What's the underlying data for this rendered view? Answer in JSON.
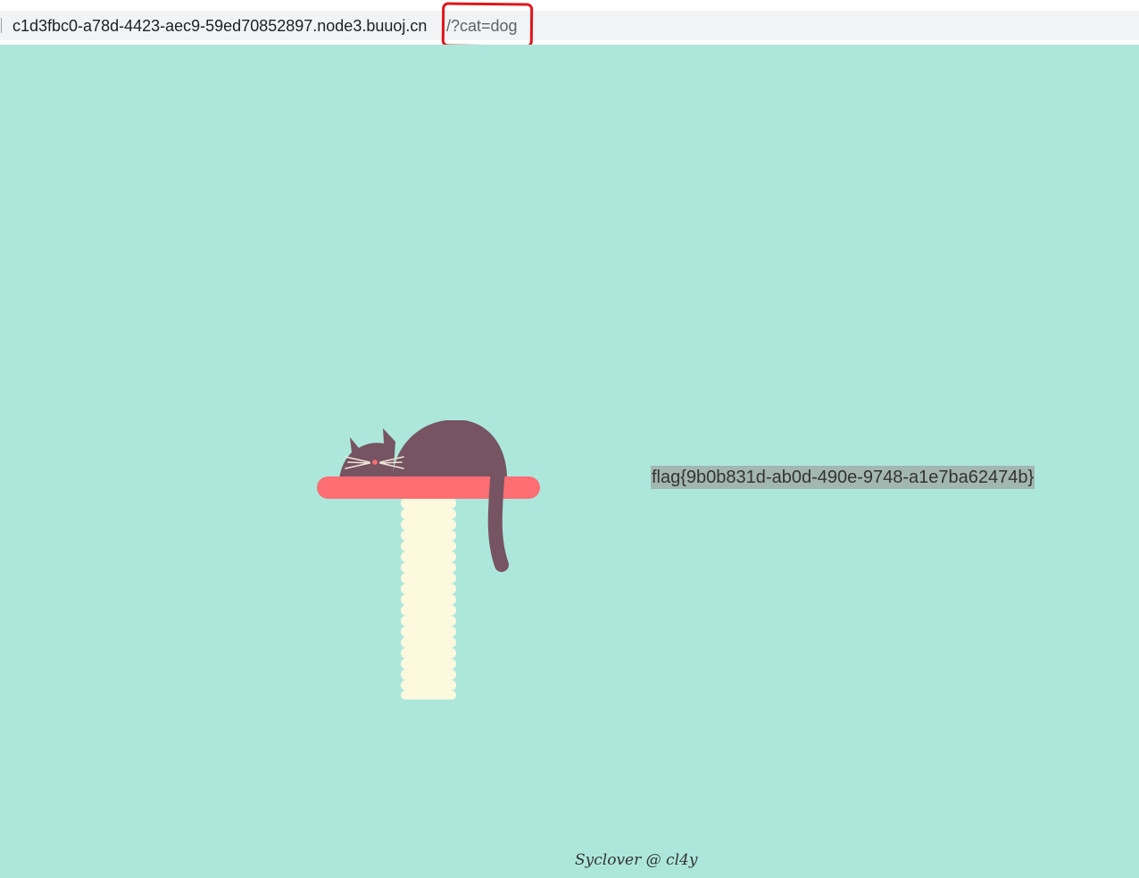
{
  "browser": {
    "url_host": "c1d3fbc0-a78d-4423-aec9-59ed70852897.node3.buuoj.cn",
    "url_path": "/?cat=dog"
  },
  "page": {
    "flag_text": "flag{9b0b831d-ab0d-490e-9748-a1e7ba62474b}",
    "footer_text": "Syclover @ cl4y"
  },
  "colors": {
    "page_background": "#ade7dc",
    "cat": "#765462",
    "shelf": "#fd6e72",
    "post": "#fdf9de",
    "annotation": "#e0151b"
  }
}
